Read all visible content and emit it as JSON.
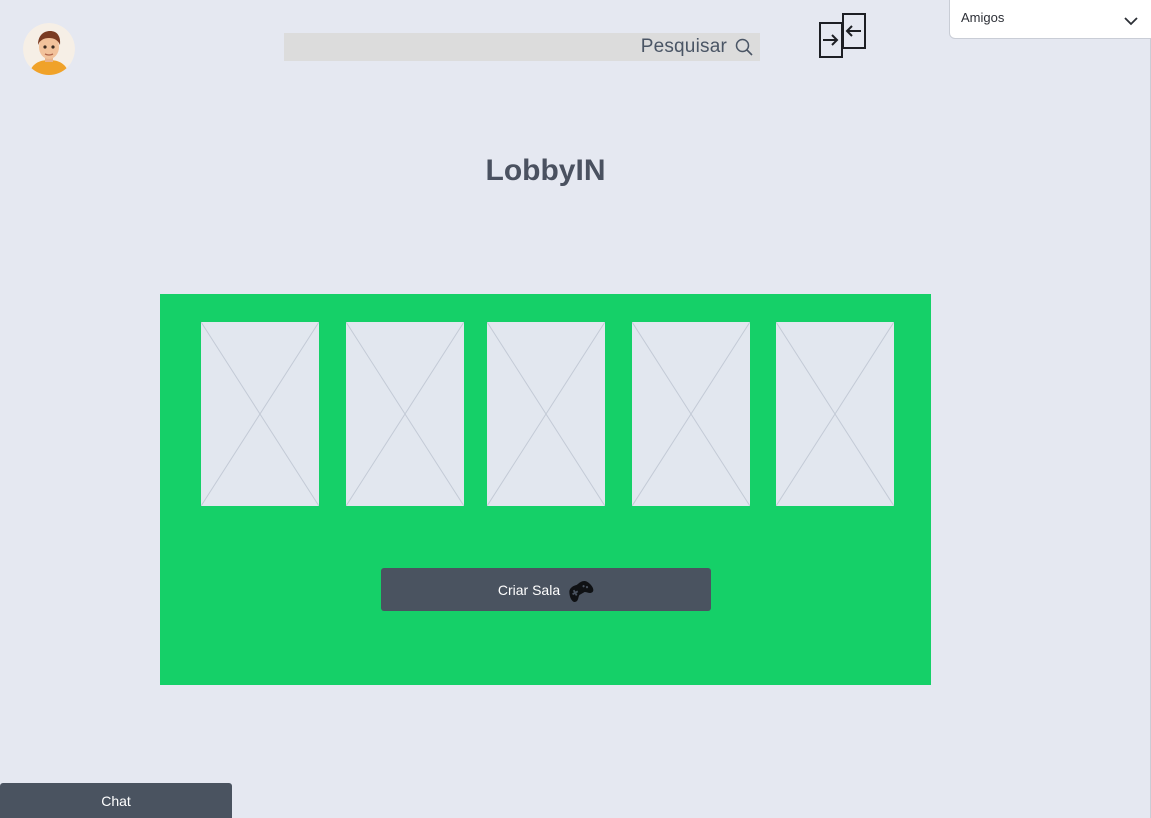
{
  "header": {
    "avatar_icon": "user-avatar",
    "search": {
      "label": "Pesquisar",
      "icon": "search-icon"
    },
    "switch_icon": "switch-arrows-icon",
    "friends_dropdown": {
      "selected": "Amigos",
      "icon": "chevron-down-icon"
    }
  },
  "main": {
    "title": "LobbyIN",
    "panel_color": "#15d068",
    "slots": [
      {
        "icon": "image-placeholder-icon"
      },
      {
        "icon": "image-placeholder-icon"
      },
      {
        "icon": "image-placeholder-icon"
      },
      {
        "icon": "image-placeholder-icon"
      },
      {
        "icon": "image-placeholder-icon"
      }
    ],
    "create_room": {
      "label": "Criar Sala",
      "icon": "gamepad-icon"
    }
  },
  "chat": {
    "label": "Chat"
  },
  "colors": {
    "background": "#e5e8f1",
    "button_dark": "#4a5360",
    "title_text": "#4a5160"
  }
}
